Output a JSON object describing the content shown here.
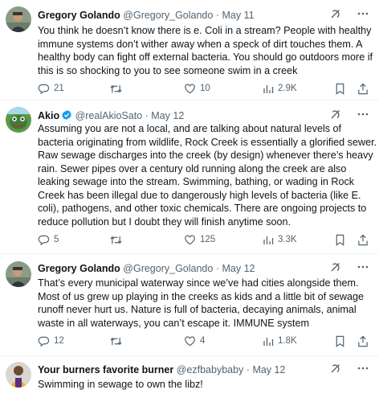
{
  "tweets": [
    {
      "name": "Gregory Golando",
      "handle": "@Gregory_Golando",
      "date": "May 11",
      "lines": [
        "You think he doesn’t know there is e. Coli in a stream? People with healthy",
        "immune systems don’t wither away when a speck of dirt touches them. A",
        "healthy body can fight off external bacteria. You should go outdoors more if",
        "this is so shocking to you to see someone swim in a creek"
      ],
      "replies": "21",
      "retweets": "",
      "likes": "10",
      "views": "2.9K"
    },
    {
      "name": "Akio",
      "handle": "@realAkioSato",
      "date": "May 12",
      "lines": [
        "Assuming you are not a local, and are talking about natural levels of",
        "bacteria originating from wildlife, Rock Creek is essentially a glorified sewer.",
        "Raw sewage discharges into the creek (by design) whenever there’s heavy",
        "rain. Sewer pipes over a century old running along the creek are also",
        "leaking sewage into the stream. Swimming, bathing, or wading in Rock",
        "Creek has been illegal due to dangerously high levels of bacteria (like E.",
        "coli), pathogens, and other toxic chemicals. There are ongoing projects to",
        "reduce pollution but I doubt they will finish anytime soon."
      ],
      "replies": "5",
      "retweets": "",
      "likes": "125",
      "views": "3.3K"
    },
    {
      "name": "Gregory Golando",
      "handle": "@Gregory_Golando",
      "date": "May 12",
      "lines": [
        "That’s every municipal waterway since we’ve had cities alongside them.",
        "Most of us grew up playing in the creeks as kids and a little bit of sewage",
        "runoff never hurt us. Nature is full of bacteria, decaying animals, animal",
        "waste in all waterways, you can’t escape it. IMMUNE system"
      ],
      "replies": "12",
      "retweets": "",
      "likes": "4",
      "views": "1.8K"
    },
    {
      "name": "Your burners favorite burner",
      "handle": "@ezfbabybaby",
      "date": "May 12",
      "lines": [
        "Swimming in sewage to own the libz!"
      ]
    }
  ],
  "separator": "·",
  "colors": {
    "text": "#0f1419",
    "secondary": "#536471",
    "verified": "#1d9bf0",
    "border": "#eff3f4"
  },
  "icons": [
    "grok-icon",
    "more-icon",
    "reply-icon",
    "retweet-icon",
    "like-icon",
    "views-icon",
    "bookmark-icon",
    "share-icon",
    "verified-badge-icon"
  ]
}
